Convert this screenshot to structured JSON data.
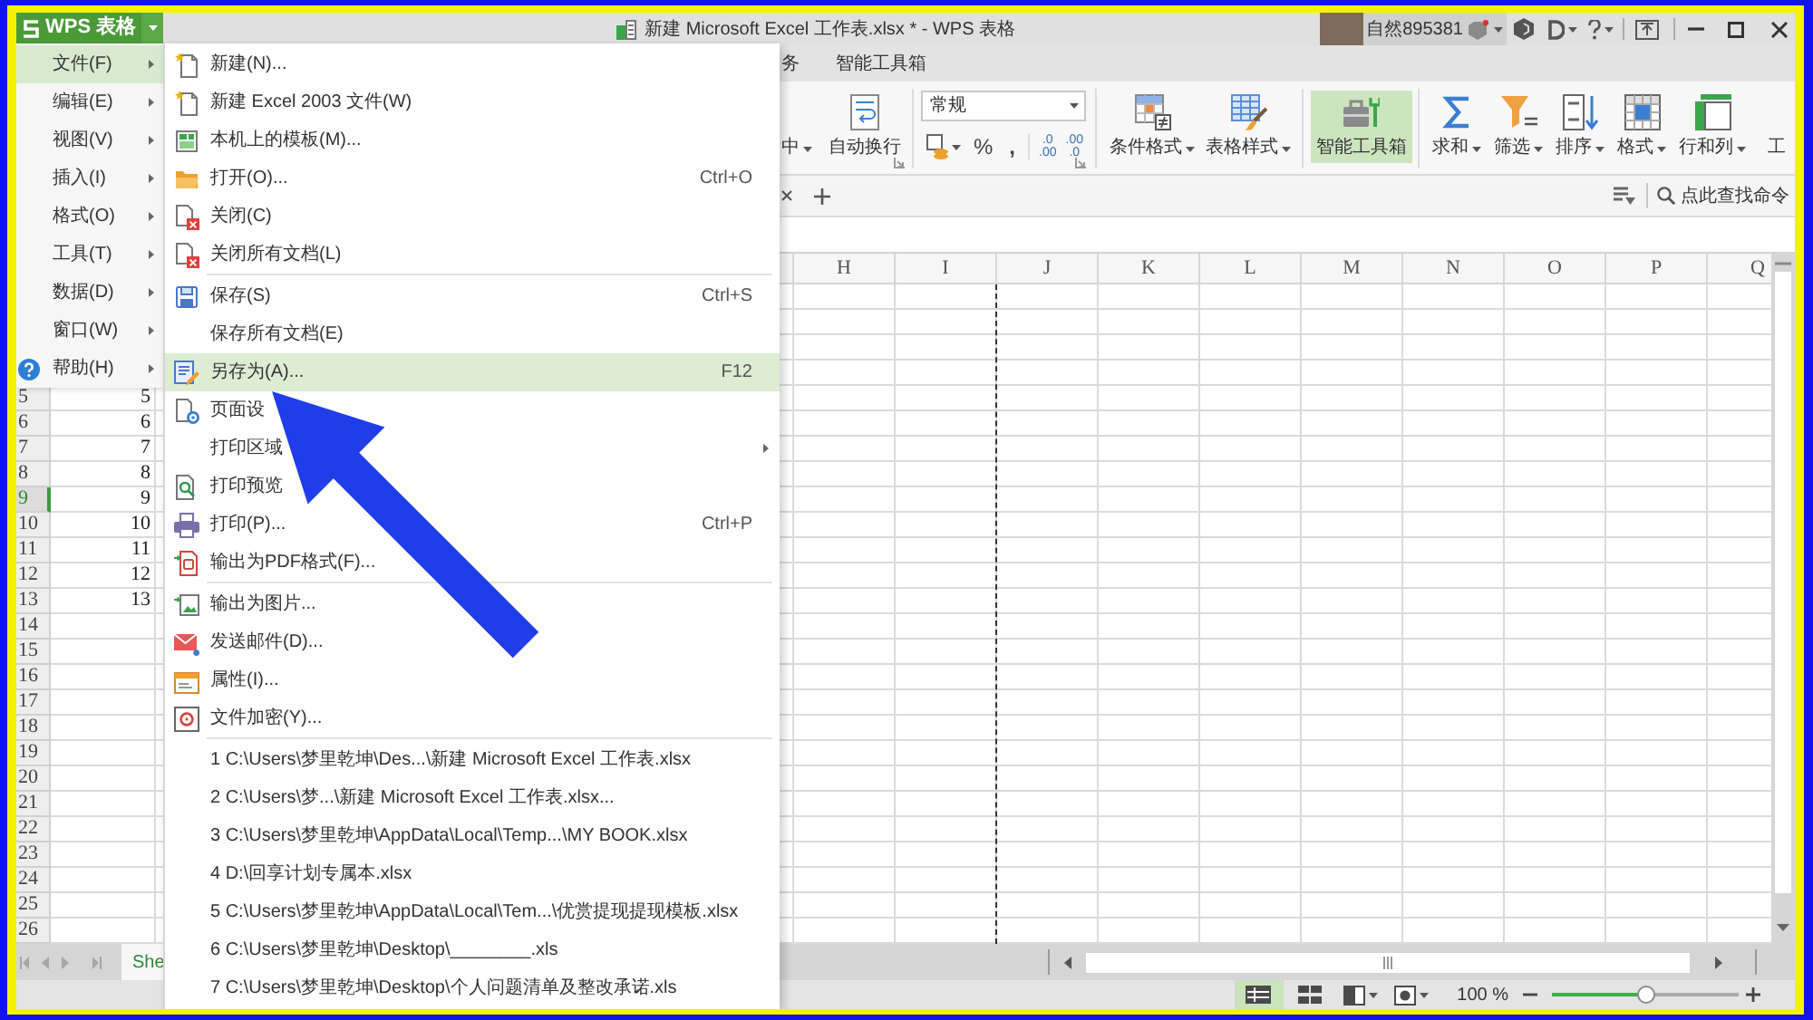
{
  "title_bar": {
    "app_button": "WPS 表格",
    "title": "新建 Microsoft Excel 工作表.xlsx * - WPS 表格",
    "user_name": "自然895381"
  },
  "ribbon_tabs": [
    {
      "label": "务",
      "selected": false
    },
    {
      "label": "智能工具箱",
      "selected": false
    }
  ],
  "ribbon": {
    "alignment_buttons": [
      {
        "label": "中",
        "dropdown": true,
        "selected": false
      },
      {
        "label": "自动换行",
        "dropdown": false,
        "selected": false
      }
    ],
    "number_format": {
      "value": "常规"
    },
    "symbol_buttons": [
      {
        "label": "%"
      },
      {
        "label": ","
      }
    ],
    "decimal_buttons": [
      {
        "lines": [
          ".0",
          ".00"
        ]
      },
      {
        "lines": [
          ".00",
          ".0"
        ]
      }
    ],
    "style_buttons": [
      {
        "label": "条件格式",
        "dropdown": true,
        "selected": false
      },
      {
        "label": "表格样式",
        "dropdown": true,
        "selected": false
      }
    ],
    "toolbox_buttons": [
      {
        "label": "智能工具箱",
        "dropdown": false,
        "selected": true
      }
    ],
    "edit_buttons": [
      {
        "label": "求和",
        "dropdown": true,
        "selected": false
      },
      {
        "label": "筛选",
        "dropdown": true,
        "selected": false
      },
      {
        "label": "排序",
        "dropdown": true,
        "selected": false
      },
      {
        "label": "格式",
        "dropdown": true,
        "selected": false
      },
      {
        "label": "行和列",
        "dropdown": true,
        "selected": false
      },
      {
        "label": "工",
        "dropdown": false,
        "selected": false
      }
    ]
  },
  "command_search": {
    "placeholder": "点此查找命令"
  },
  "sheet": {
    "columns": [
      {
        "label": "H",
        "page_break": false
      },
      {
        "label": "I",
        "page_break": true
      },
      {
        "label": "J",
        "page_break": false
      },
      {
        "label": "K",
        "page_break": false
      },
      {
        "label": "L",
        "page_break": false
      },
      {
        "label": "M",
        "page_break": false
      },
      {
        "label": "N",
        "page_break": false
      },
      {
        "label": "O",
        "page_break": false
      },
      {
        "label": "P",
        "page_break": false
      },
      {
        "label": "Q",
        "page_break": false
      }
    ],
    "rows": [
      {
        "header": "5",
        "value": "5",
        "selected": false
      },
      {
        "header": "6",
        "value": "6",
        "selected": false
      },
      {
        "header": "7",
        "value": "7",
        "selected": false
      },
      {
        "header": "8",
        "value": "8",
        "selected": false
      },
      {
        "header": "9",
        "value": "9",
        "selected": true
      },
      {
        "header": "10",
        "value": "10",
        "selected": false
      },
      {
        "header": "11",
        "value": "11",
        "selected": false
      },
      {
        "header": "12",
        "value": "12",
        "selected": false
      },
      {
        "header": "13",
        "value": "13",
        "selected": false
      },
      {
        "header": "14",
        "selected": false
      },
      {
        "header": "15",
        "selected": false
      },
      {
        "header": "16",
        "selected": false
      },
      {
        "header": "17",
        "selected": false
      },
      {
        "header": "18",
        "selected": false
      },
      {
        "header": "19",
        "selected": false
      },
      {
        "header": "20",
        "selected": false
      },
      {
        "header": "21",
        "selected": false
      },
      {
        "header": "22",
        "selected": false
      },
      {
        "header": "23",
        "selected": false
      },
      {
        "header": "24",
        "selected": false
      },
      {
        "header": "25",
        "selected": false
      },
      {
        "header": "26",
        "selected": false
      }
    ]
  },
  "sheet_tabs": [
    {
      "label": "She",
      "selected": true
    }
  ],
  "status_bar": {
    "view_buttons": [
      {
        "selected": true,
        "dropdown": false
      },
      {
        "selected": false,
        "dropdown": false
      },
      {
        "selected": false,
        "dropdown": true
      },
      {
        "selected": false,
        "dropdown": true
      }
    ],
    "zoom": {
      "reading": "100 %",
      "level": 0.5
    }
  },
  "main_menu": [
    {
      "label": "文件(F)",
      "selected": true,
      "kind": "plain",
      "submenu": true
    },
    {
      "label": "编辑(E)",
      "selected": false,
      "kind": "plain",
      "submenu": true
    },
    {
      "label": "视图(V)",
      "selected": false,
      "kind": "plain",
      "submenu": true
    },
    {
      "label": "插入(I)",
      "selected": false,
      "kind": "plain",
      "submenu": true
    },
    {
      "label": "格式(O)",
      "selected": false,
      "kind": "plain",
      "submenu": true
    },
    {
      "label": "工具(T)",
      "selected": false,
      "kind": "plain",
      "submenu": true
    },
    {
      "label": "数据(D)",
      "selected": false,
      "kind": "plain",
      "submenu": true
    },
    {
      "label": "窗口(W)",
      "selected": false,
      "kind": "plain",
      "submenu": true
    },
    {
      "label": "帮助(H)",
      "selected": false,
      "kind": "help",
      "submenu": true
    }
  ],
  "file_menu": {
    "sections": [
      [
        {
          "label": "新建(N)...",
          "selected": false,
          "submenu": false
        },
        {
          "label": "新建 Excel 2003 文件(W)",
          "selected": false,
          "submenu": false
        },
        {
          "label": "本机上的模板(M)...",
          "selected": false,
          "submenu": false
        },
        {
          "label": "打开(O)...",
          "shortcut": "Ctrl+O",
          "selected": false,
          "submenu": false
        },
        {
          "label": "关闭(C)",
          "selected": false,
          "submenu": false
        },
        {
          "label": "关闭所有文档(L)",
          "selected": false,
          "submenu": false
        }
      ],
      [
        {
          "label": "保存(S)",
          "shortcut": "Ctrl+S",
          "selected": false,
          "submenu": false
        },
        {
          "label": "保存所有文档(E)",
          "selected": false,
          "submenu": false
        },
        {
          "label": "另存为(A)...",
          "shortcut": "F12",
          "selected": true,
          "submenu": false
        },
        {
          "label": "页面设",
          "selected": false,
          "submenu": false
        },
        {
          "label": "打印区域",
          "selected": false,
          "submenu": true
        },
        {
          "label": "打印预览",
          "selected": false,
          "submenu": false
        },
        {
          "label": "打印(P)...",
          "shortcut": "Ctrl+P",
          "selected": false,
          "submenu": false
        },
        {
          "label": "输出为PDF格式(F)...",
          "selected": false,
          "submenu": false
        }
      ],
      [
        {
          "label": "输出为图片...",
          "selected": false,
          "submenu": false
        },
        {
          "label": "发送邮件(D)...",
          "selected": false,
          "submenu": false
        },
        {
          "label": "属性(I)...",
          "selected": false,
          "submenu": false
        },
        {
          "label": "文件加密(Y)...",
          "selected": false,
          "submenu": false
        }
      ]
    ],
    "recent_files": [
      {
        "label": "1 C:\\Users\\梦里乾坤\\Des...\\新建 Microsoft Excel 工作表.xlsx",
        "selected": false
      },
      {
        "label": "2 C:\\Users\\梦...\\新建 Microsoft Excel 工作表.xlsx...",
        "selected": false
      },
      {
        "label": "3 C:\\Users\\梦里乾坤\\AppData\\Local\\Temp...\\MY BOOK.xlsx",
        "selected": false
      },
      {
        "label": "4 D:\\回享计划专属本.xlsx",
        "selected": false
      },
      {
        "label": "5 C:\\Users\\梦里乾坤\\AppData\\Local\\Tem...\\优赏提现提现模板.xlsx",
        "selected": false
      },
      {
        "label": "6 C:\\Users\\梦里乾坤\\Desktop\\________.xls",
        "selected": false
      },
      {
        "label": "7 C:\\Users\\梦里乾坤\\Desktop\\个人问题清单及整改承诺.xls",
        "selected": false
      }
    ]
  }
}
